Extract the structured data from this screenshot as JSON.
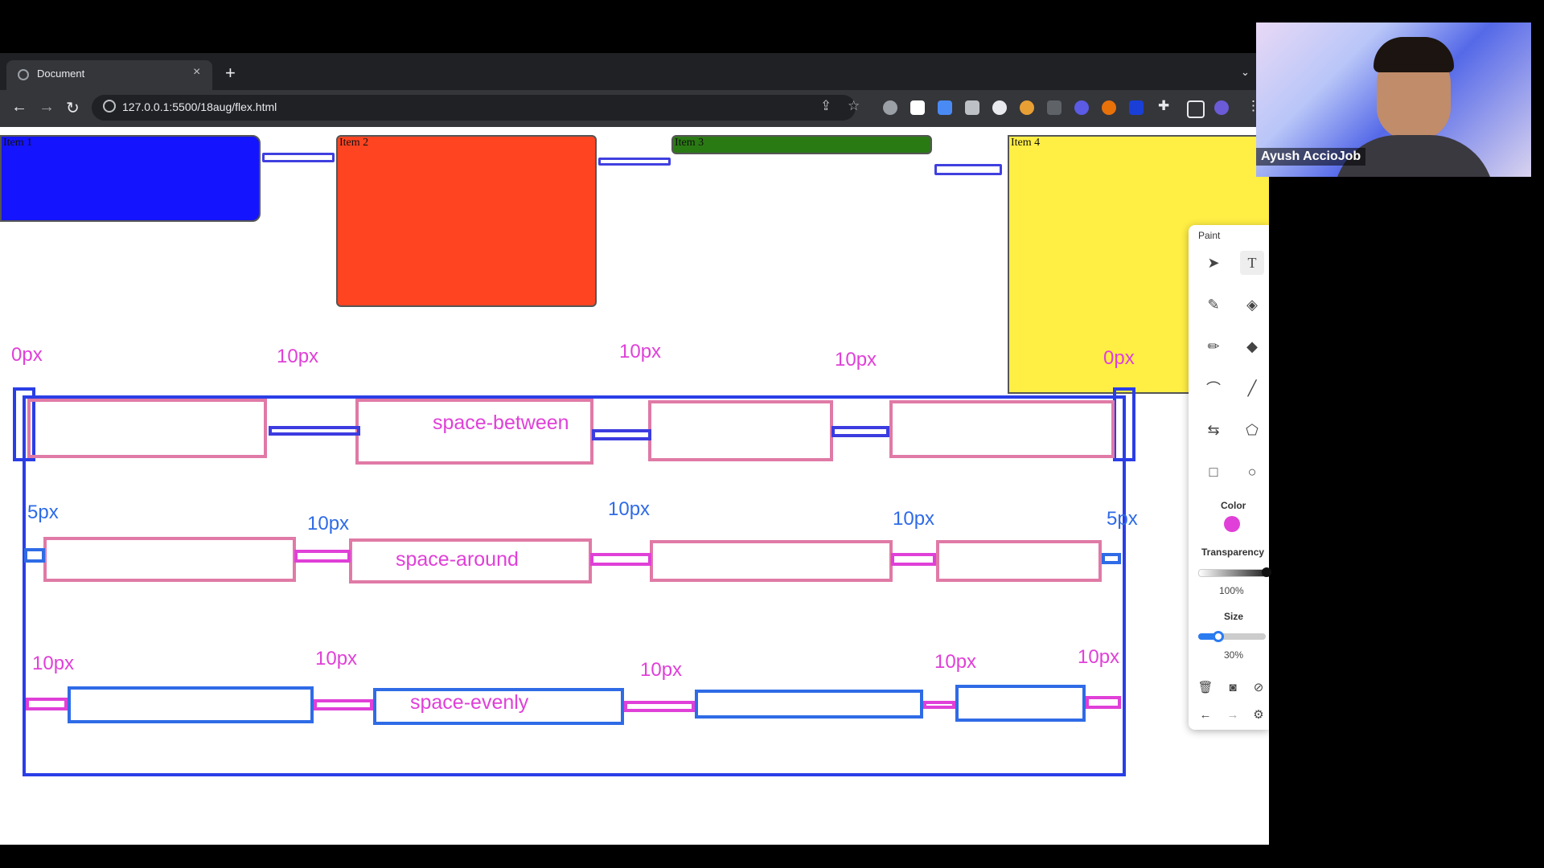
{
  "browser": {
    "tab_title": "Document",
    "tab_close": "×",
    "new_tab": "+",
    "tab_list": "⌄",
    "back": "←",
    "forward": "→",
    "reload": "↻",
    "url": "127.0.0.1:5500/18aug/flex.html"
  },
  "page": {
    "items": [
      "Item 1",
      "Item 2",
      "Item 3",
      "Item 4"
    ],
    "item_colors": [
      "#1414ff",
      "#ff4422",
      "#2a7a14",
      "#ffee44"
    ]
  },
  "annotations": {
    "row1": {
      "name": "space-between",
      "labels": [
        "0px",
        "10px",
        "10px",
        "10px",
        "0px"
      ]
    },
    "row2": {
      "name": "space-around",
      "labels": [
        "5px",
        "10px",
        "10px",
        "10px",
        "5px"
      ]
    },
    "row3": {
      "name": "space-evenly",
      "labels": [
        "10px",
        "10px",
        "10px",
        "10px",
        "10px"
      ]
    }
  },
  "paint": {
    "title": "Paint",
    "color_label": "Color",
    "color": "#e040d8",
    "transparency_label": "Transparency",
    "transparency_value": "100%",
    "transparency_level": 1.0,
    "size_label": "Size",
    "size_value": "30%",
    "size_level": 0.3
  },
  "webcam": {
    "name": "Ayush AccioJob"
  }
}
